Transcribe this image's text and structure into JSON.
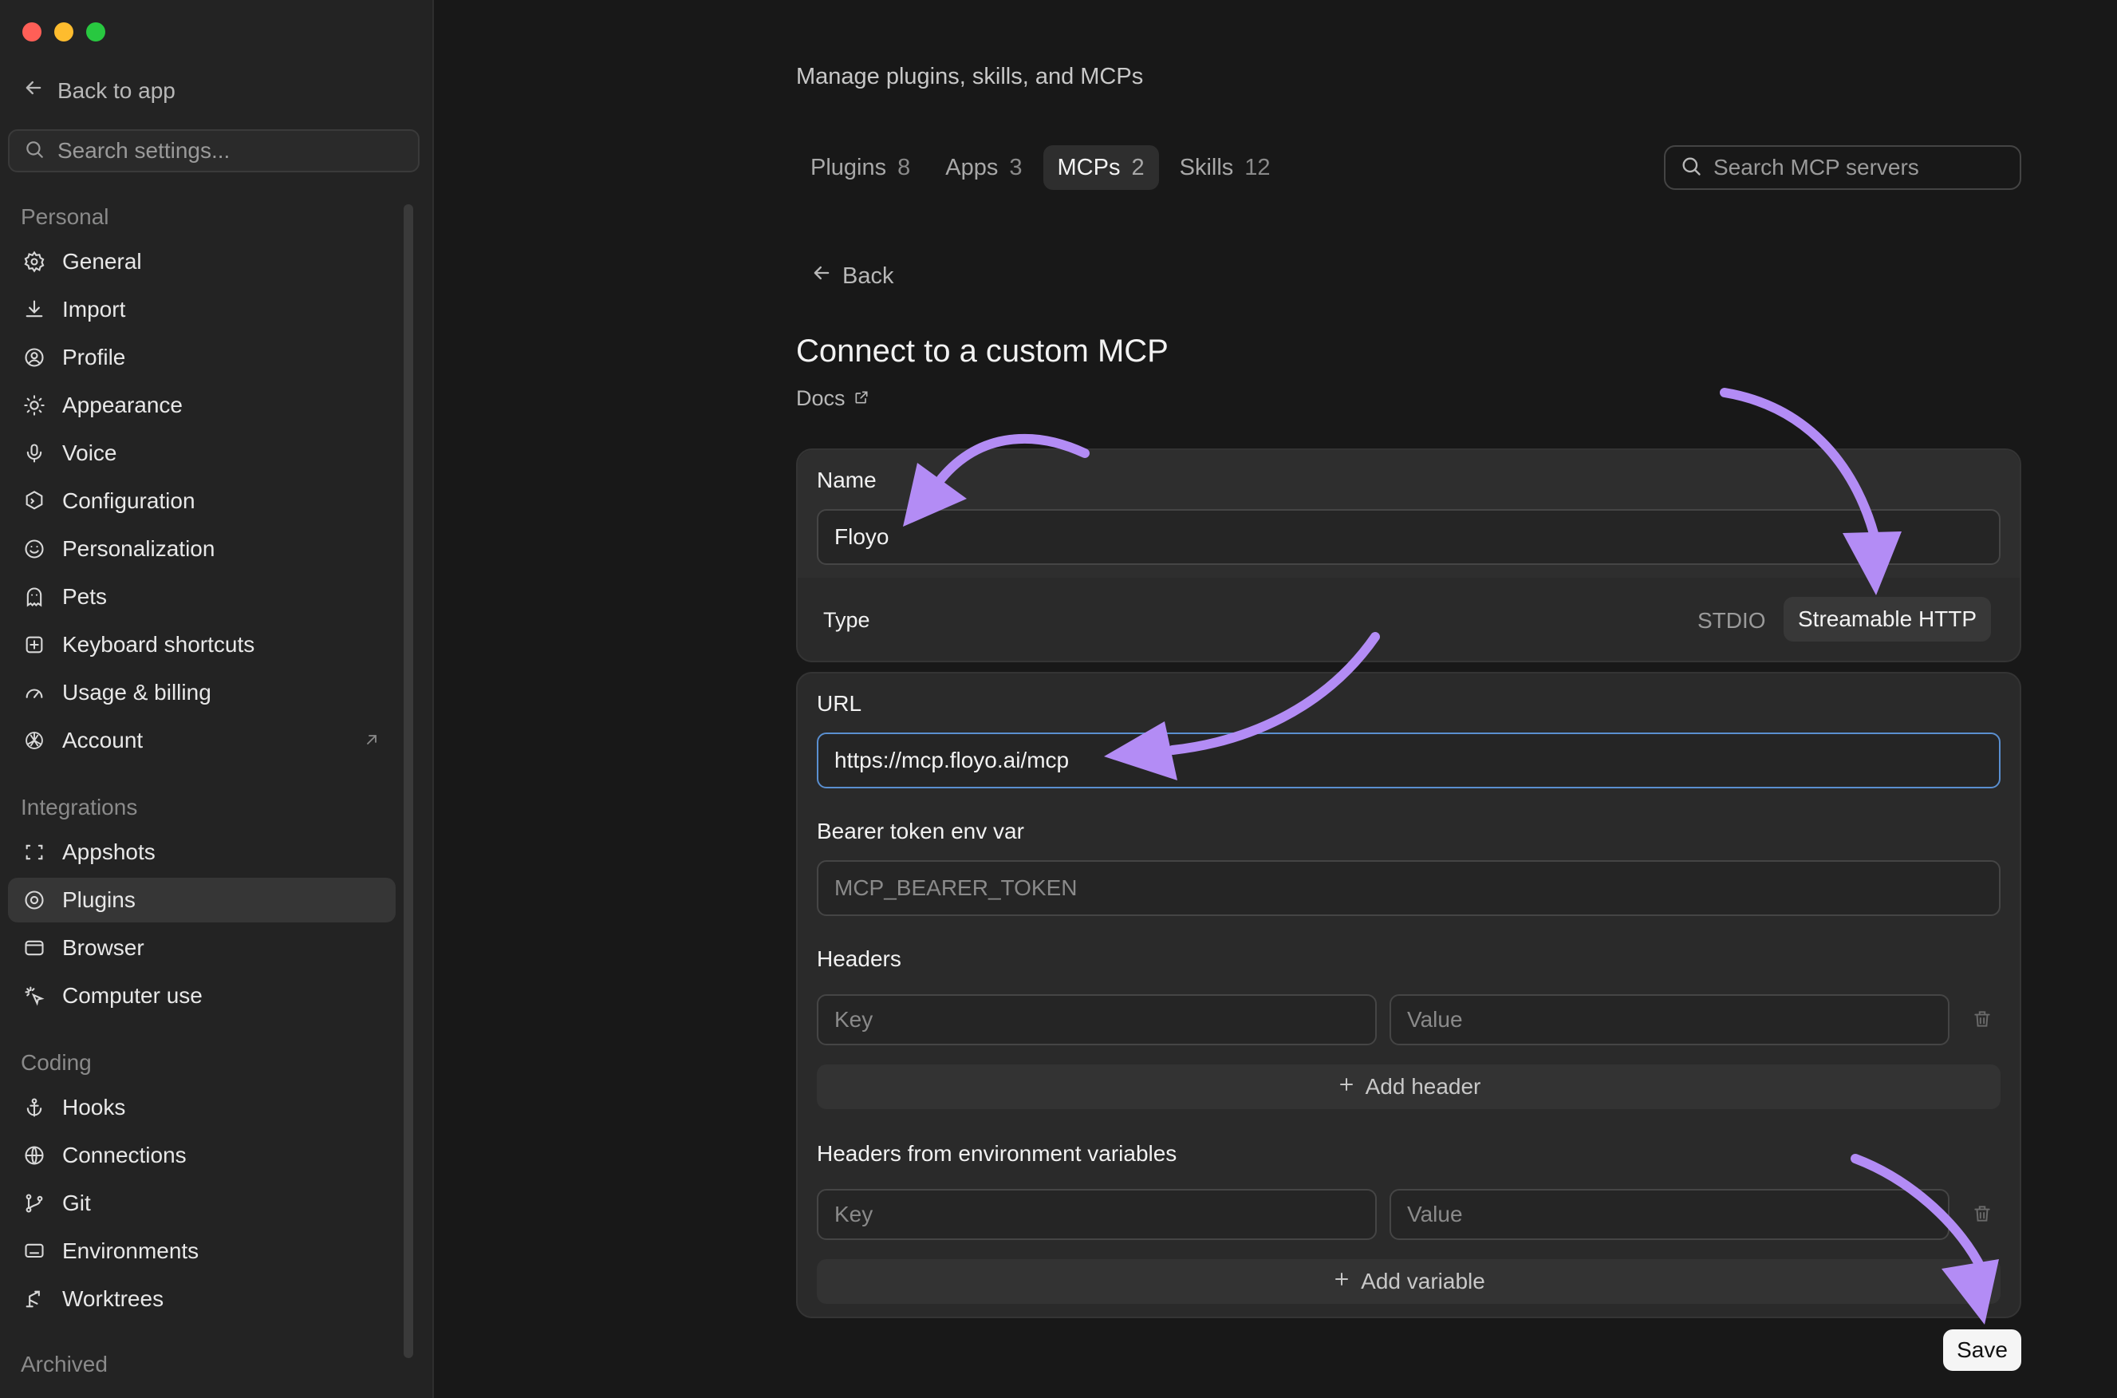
{
  "sidebar": {
    "back_label": "Back to app",
    "search_placeholder": "Search settings...",
    "sections": {
      "personal": "Personal",
      "integrations": "Integrations",
      "coding": "Coding",
      "archived": "Archived"
    },
    "items": {
      "general": "General",
      "import": "Import",
      "profile": "Profile",
      "appearance": "Appearance",
      "voice": "Voice",
      "configuration": "Configuration",
      "personalization": "Personalization",
      "pets": "Pets",
      "keyboard_shortcuts": "Keyboard shortcuts",
      "usage_billing": "Usage & billing",
      "account": "Account",
      "appshots": "Appshots",
      "plugins": "Plugins",
      "browser": "Browser",
      "computer_use": "Computer use",
      "hooks": "Hooks",
      "connections": "Connections",
      "git": "Git",
      "environments": "Environments",
      "worktrees": "Worktrees"
    },
    "active_item": "Plugins"
  },
  "header": {
    "subtitle": "Manage plugins, skills, and MCPs",
    "tabs": [
      {
        "label": "Plugins",
        "count": "8"
      },
      {
        "label": "Apps",
        "count": "3"
      },
      {
        "label": "MCPs",
        "count": "2"
      },
      {
        "label": "Skills",
        "count": "12"
      }
    ],
    "active_tab": "MCPs",
    "search_placeholder": "Search MCP servers"
  },
  "form": {
    "back_label": "Back",
    "title": "Connect to a custom MCP",
    "docs_label": "Docs",
    "name_label": "Name",
    "name_value": "Floyo",
    "type_label": "Type",
    "type_options": [
      "STDIO",
      "Streamable HTTP"
    ],
    "type_selected": "Streamable HTTP",
    "url_label": "URL",
    "url_value": "https://mcp.floyo.ai/mcp",
    "bearer_label": "Bearer token env var",
    "bearer_placeholder": "MCP_BEARER_TOKEN",
    "headers_label": "Headers",
    "key_placeholder": "Key",
    "value_placeholder": "Value",
    "add_header_label": "Add header",
    "env_headers_label": "Headers from environment variables",
    "add_variable_label": "Add variable",
    "save_label": "Save"
  },
  "colors": {
    "annotation_arrow": "#b38cf5",
    "focus_border": "#5a8fd0",
    "background": "#181818",
    "sidebar": "#232323"
  }
}
